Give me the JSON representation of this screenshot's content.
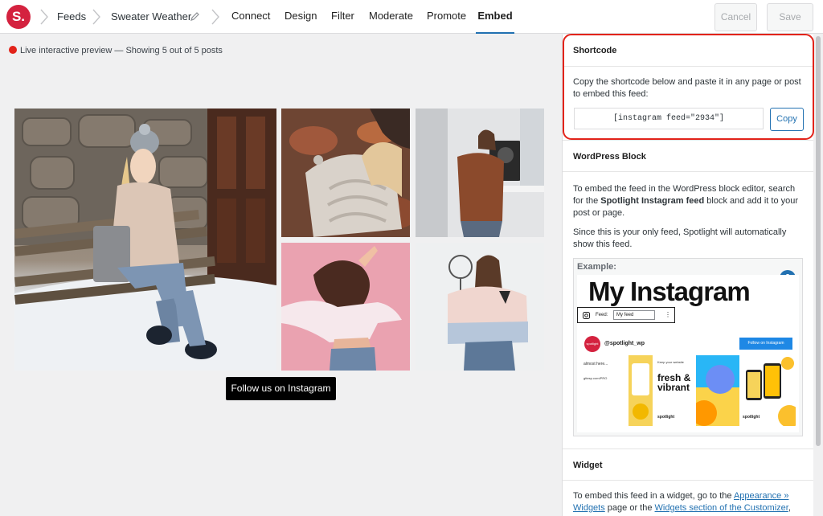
{
  "header": {
    "logo_text": "S.",
    "breadcrumb": {
      "feeds": "Feeds",
      "feed_name": "Sweater Weather"
    },
    "tabs": [
      {
        "label": "Connect"
      },
      {
        "label": "Design"
      },
      {
        "label": "Filter"
      },
      {
        "label": "Moderate"
      },
      {
        "label": "Promote"
      },
      {
        "label": "Embed",
        "active": true
      }
    ],
    "cancel_label": "Cancel",
    "save_label": "Save"
  },
  "preview": {
    "status_text": "Live interactive preview — Showing 5 out of 5 posts",
    "follow_button": "Follow us on Instagram"
  },
  "sidebar": {
    "shortcode": {
      "heading": "Shortcode",
      "description": "Copy the shortcode below and paste it in any page or post to embed this feed:",
      "value": "[instagram feed=\"2934\"]",
      "copy_label": "Copy"
    },
    "wp_block": {
      "heading": "WordPress Block",
      "para1_a": "To embed the feed in the WordPress block editor, search for the ",
      "para1_bold": "Spotlight Instagram feed",
      "para1_b": " block and add it to your post or page.",
      "para2": "Since this is your only feed, Spotlight will automatically show this feed.",
      "example_label": "Example:",
      "example_badge": "2",
      "example_title": "My Instagram",
      "example_feed_label": "Feed:",
      "example_feed_value": "My feed",
      "example_avatar": "spotlight",
      "example_handle": "@spotlight_wp",
      "example_follow": "Follow on Instagram",
      "example_tile1_text": "almost here...",
      "example_tile1_url": "gttesp.com/PRO",
      "example_tile2_text": "fresh & vibrant",
      "example_tile2_caption": "Keep your website",
      "example_tile_brand": "spotlight"
    },
    "widget": {
      "heading": "Widget",
      "text_a": "To embed this feed in a widget, go to the ",
      "link1": "Appearance » Widgets",
      "text_b": " page or the ",
      "link2": "Widgets section of the Customizer",
      "text_c": ","
    }
  },
  "colors": {
    "brand": "#d4223f",
    "accent": "#2271b1",
    "highlight": "#e2231a"
  }
}
